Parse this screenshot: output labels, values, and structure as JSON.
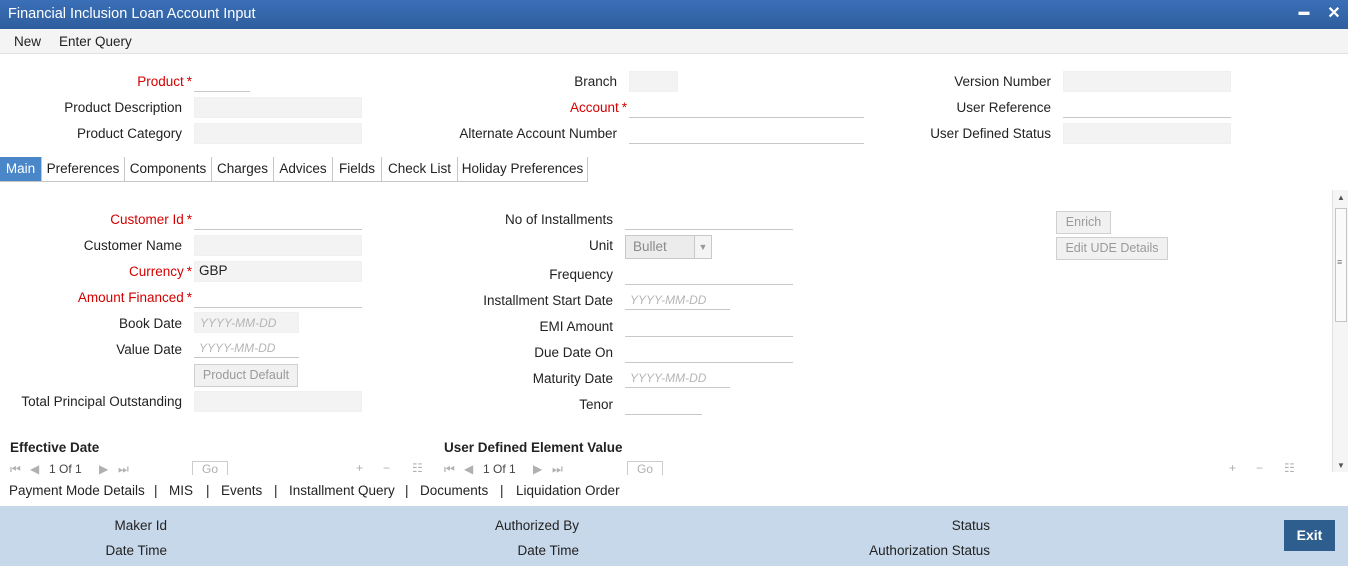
{
  "window": {
    "title": "Financial Inclusion Loan Account Input",
    "minimize_glyph": "▬",
    "close_glyph": "✕"
  },
  "menu": {
    "new": "New",
    "enter_query": "Enter Query"
  },
  "header": {
    "product": "Product",
    "product_description": "Product Description",
    "product_category": "Product Category",
    "branch": "Branch",
    "account": "Account",
    "alternate_account_number": "Alternate Account Number",
    "version_number": "Version Number",
    "user_reference": "User Reference",
    "user_defined_status": "User Defined Status",
    "required_marker": "*"
  },
  "tabs": [
    "Main",
    "Preferences",
    "Components",
    "Charges",
    "Advices",
    "Fields",
    "Check List",
    "Holiday Preferences"
  ],
  "main": {
    "customer_id": "Customer Id",
    "customer_name": "Customer Name",
    "currency": "Currency",
    "currency_value": "GBP",
    "amount_financed": "Amount Financed",
    "book_date": "Book Date",
    "value_date": "Value Date",
    "date_placeholder": "YYYY-MM-DD",
    "product_default_button": "Product Default",
    "total_principal_outstanding": "Total Principal Outstanding",
    "no_of_installments": "No of Installments",
    "unit": "Unit",
    "unit_value": "Bullet",
    "frequency": "Frequency",
    "installment_start_date": "Installment Start Date",
    "emi_amount": "EMI Amount",
    "due_date_on": "Due Date On",
    "maturity_date": "Maturity Date",
    "tenor": "Tenor",
    "enrich_button": "Enrich",
    "edit_ude_button": "Edit UDE Details"
  },
  "sections": {
    "effective_date": "Effective Date",
    "user_defined_element_value": "User Defined Element Value",
    "pager_text": "1 Of 1",
    "go": "Go"
  },
  "links": [
    "Payment Mode Details",
    "MIS",
    "Events",
    "Installment Query",
    "Documents",
    "Liquidation Order"
  ],
  "link_separator": "|",
  "footer": {
    "maker_id": "Maker Id",
    "date_time": "Date Time",
    "authorized_by": "Authorized By",
    "status": "Status",
    "authorization_status": "Authorization Status",
    "exit": "Exit"
  },
  "colors": {
    "title_bar": "#2e5e9e",
    "active_tab": "#4a87c9",
    "required": "#d40000",
    "footer": "#c7d8ea",
    "exit_button": "#2e5e8e"
  },
  "icons": [
    "minimize-icon",
    "close-icon",
    "first-page-icon",
    "prev-page-icon",
    "next-page-icon",
    "last-page-icon",
    "add-row-icon",
    "delete-row-icon",
    "view-icon",
    "dropdown-arrow-icon",
    "scroll-up-icon",
    "scroll-down-icon",
    "scroll-grip-icon"
  ]
}
